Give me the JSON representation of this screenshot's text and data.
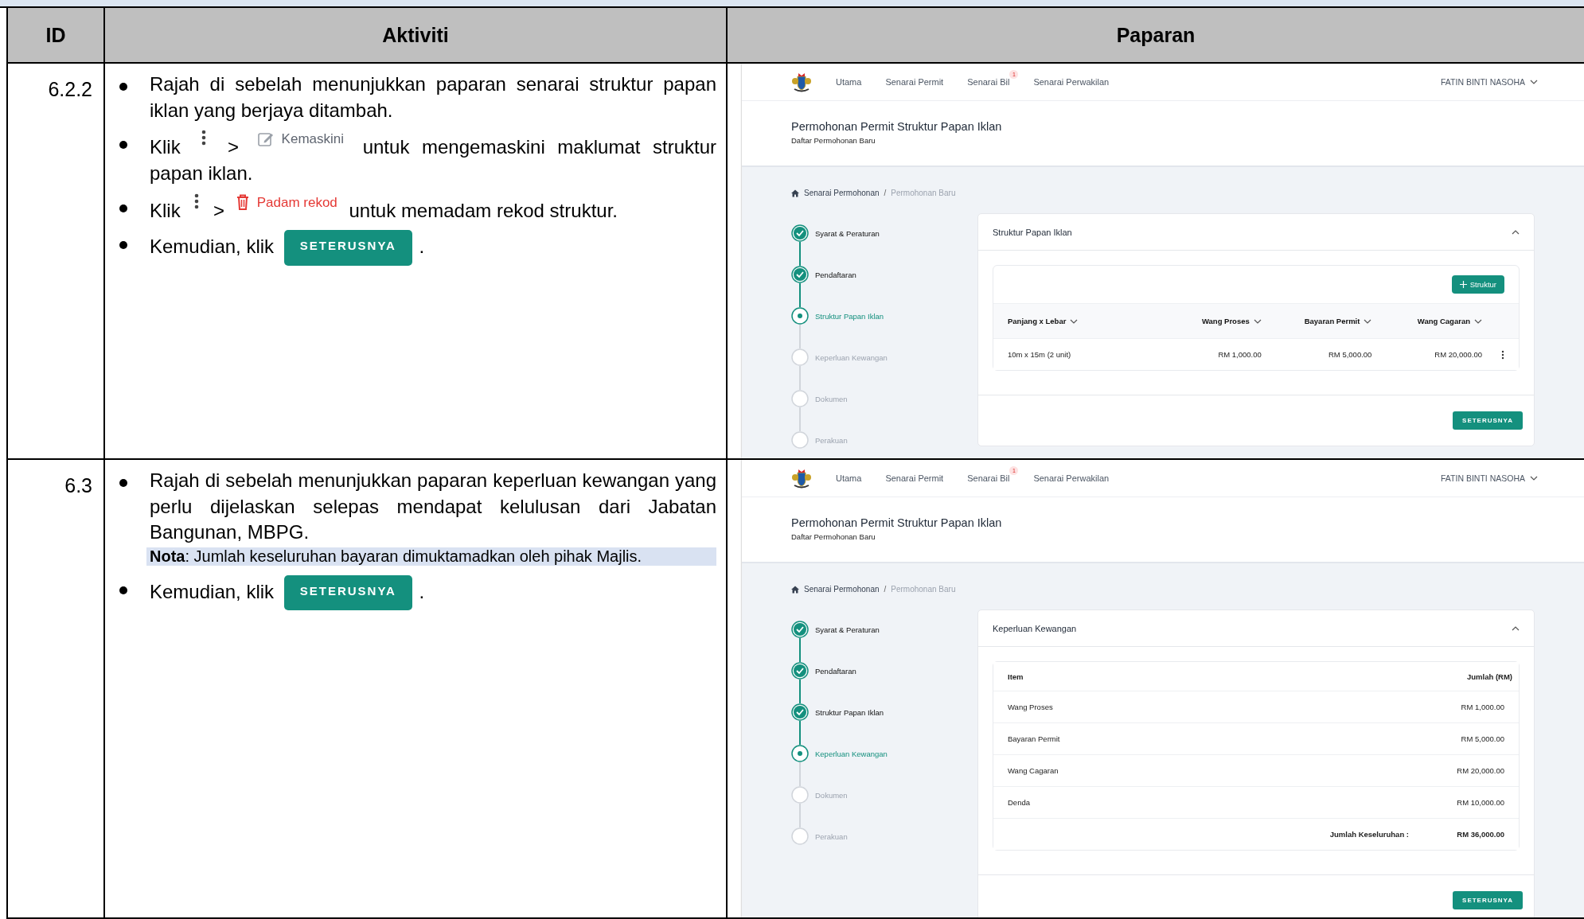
{
  "table": {
    "columns": [
      "ID",
      "Aktiviti",
      "Paparan"
    ],
    "rows": [
      {
        "id": "6.2.2",
        "bullets": [
          {
            "segments": [
              {
                "kind": "text",
                "text": "Rajah di sebelah menunjukkan paparan senarai struktur papan iklan yang berjaya ditambah."
              }
            ]
          },
          {
            "segments": [
              {
                "kind": "text",
                "text": "Klik"
              },
              {
                "kind": "kebab"
              },
              {
                "kind": "text",
                "text": ">"
              },
              {
                "kind": "edit",
                "label": "Kemaskini"
              },
              {
                "kind": "text",
                "text": "untuk mengemaskini maklumat struktur"
              },
              {
                "kind": "text",
                "text": "papan iklan."
              }
            ]
          },
          {
            "segments": [
              {
                "kind": "text",
                "text": "Klik"
              },
              {
                "kind": "kebab"
              },
              {
                "kind": "text",
                "text": ">"
              },
              {
                "kind": "delete",
                "label": "Padam rekod"
              },
              {
                "kind": "text",
                "text": "untuk memadam rekod struktur."
              }
            ]
          },
          {
            "segments": [
              {
                "kind": "text",
                "text": "Kemudian, klik"
              },
              {
                "kind": "button",
                "label": "SETERUSNYA"
              },
              {
                "kind": "text",
                "text": "."
              }
            ]
          }
        ],
        "screen": {
          "nav": {
            "items": [
              {
                "label": "Utama"
              },
              {
                "label": "Senarai Permit"
              },
              {
                "label": "Senarai Bil",
                "badge": "1"
              },
              {
                "label": "Senarai Perwakilan"
              }
            ],
            "user": "FATIN BINTI NASOHA"
          },
          "title": "Permohonan Permit Struktur Papan Iklan",
          "subtitle": "Daftar Permohonan Baru",
          "breadcrumb": [
            {
              "label": "Senarai Permohonan",
              "current": false
            },
            {
              "label": "Permohonan Baru",
              "current": true
            }
          ],
          "breadcrumb_separator": "/",
          "steps": [
            {
              "label": "Syarat & Peraturan",
              "done": true,
              "current": false
            },
            {
              "label": "Pendaftaran",
              "done": true,
              "current": false
            },
            {
              "label": "Struktur Papan Iklan",
              "done": false,
              "current": true
            },
            {
              "label": "Keperluan Kewangan",
              "done": false,
              "current": false
            },
            {
              "label": "Dokumen",
              "done": false,
              "current": false
            },
            {
              "label": "Perakuan",
              "done": false,
              "current": false
            }
          ],
          "panel": {
            "kind": "structures",
            "title": "Struktur Papan Iklan",
            "expanded": true,
            "add_button": "Struktur",
            "columns": [
              "Panjang x Lebar",
              "Wang Proses",
              "Bayaran Permit",
              "Wang Cagaran"
            ],
            "rows": [
              {
                "cells": [
                  "10m x 15m (2 unit)",
                  "RM 1,000.00",
                  "RM 5,000.00",
                  "RM 20,000.00"
                ]
              }
            ]
          },
          "next_button": "SETERUSNYA"
        }
      },
      {
        "id": "6.3",
        "bullets": [
          {
            "segments": [
              {
                "kind": "text",
                "text": "Rajah di sebelah menunjukkan paparan keperluan kewangan yang perlu dijelaskan selepas mendapat kelulusan dari Jabatan Bangunan, MBPG."
              }
            ],
            "note": "**Nota**: Jumlah keseluruhan bayaran dimuktamadkan oleh pihak Majlis."
          },
          {
            "segments": [
              {
                "kind": "text",
                "text": "Kemudian, klik"
              },
              {
                "kind": "button",
                "label": "SETERUSNYA"
              },
              {
                "kind": "text",
                "text": "."
              }
            ]
          }
        ],
        "screen": {
          "nav": {
            "items": [
              {
                "label": "Utama"
              },
              {
                "label": "Senarai Permit"
              },
              {
                "label": "Senarai Bil",
                "badge": "1"
              },
              {
                "label": "Senarai Perwakilan"
              }
            ],
            "user": "FATIN BINTI NASOHA"
          },
          "title": "Permohonan Permit Struktur Papan Iklan",
          "subtitle": "Daftar Permohonan Baru",
          "breadcrumb": [
            {
              "label": "Senarai Permohonan",
              "current": false
            },
            {
              "label": "Permohonan Baru",
              "current": true
            }
          ],
          "breadcrumb_separator": "/",
          "steps": [
            {
              "label": "Syarat & Peraturan",
              "done": true,
              "current": false
            },
            {
              "label": "Pendaftaran",
              "done": true,
              "current": false
            },
            {
              "label": "Struktur Papan Iklan",
              "done": true,
              "current": false
            },
            {
              "label": "Keperluan Kewangan",
              "done": false,
              "current": true
            },
            {
              "label": "Dokumen",
              "done": false,
              "current": false
            },
            {
              "label": "Perakuan",
              "done": false,
              "current": false
            }
          ],
          "panel": {
            "kind": "summary",
            "title": "Keperluan Kewangan",
            "expanded": true,
            "columns": [
              "Item",
              "Jumlah (RM)"
            ],
            "rows": [
              {
                "cells": [
                  "Wang Proses",
                  "RM 1,000.00"
                ]
              },
              {
                "cells": [
                  "Bayaran Permit",
                  "RM 5,000.00"
                ]
              },
              {
                "cells": [
                  "Wang Cagaran",
                  "RM 20,000.00"
                ]
              },
              {
                "cells": [
                  "Denda",
                  "RM 10,000.00"
                ]
              }
            ],
            "total": {
              "label": "Jumlah Keseluruhan :",
              "amount": "RM 36,000.00"
            }
          },
          "next_button": "SETERUSNYA"
        }
      }
    ]
  }
}
